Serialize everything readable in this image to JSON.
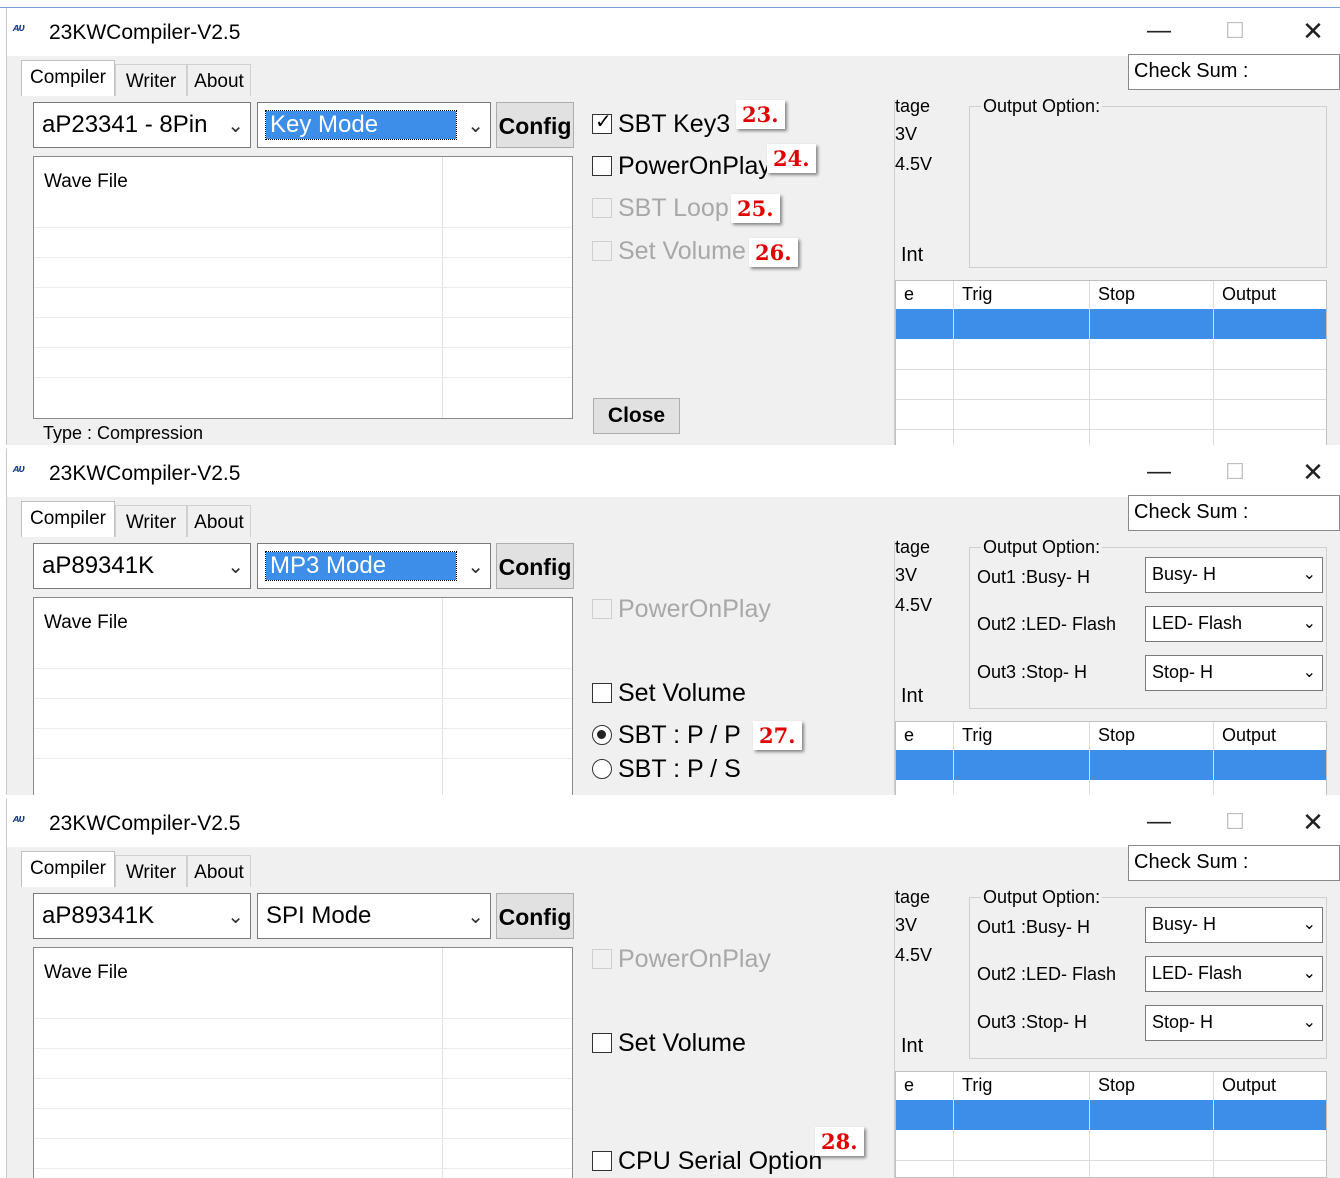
{
  "app": {
    "title": "23KWCompiler-V2.5",
    "icon_text": "ᴀᴜ",
    "minimize": "—",
    "maximize": "☐",
    "close": "✕"
  },
  "tabs": [
    "Compiler",
    "Writer",
    "About"
  ],
  "checksum_label": "Check Sum :",
  "config_label": "Config",
  "wave_file_label": "Wave File",
  "fragments": {
    "voltage": "tage",
    "v3": "3V",
    "v45": "4.5V",
    "int": "Int",
    "grid_first": "e"
  },
  "output_option_label": "Output Option:",
  "grid_headers": [
    "Trig",
    "Stop",
    "Output"
  ],
  "colors": {
    "selection": "#3d8ee8",
    "badge_red": "#e00000"
  },
  "panel1": {
    "chip": "aP23341 - 8Pin",
    "mode": "Key Mode",
    "options": [
      {
        "label": "SBT Key3",
        "checked": true,
        "enabled": true,
        "badge": "23."
      },
      {
        "label": "PowerOnPlay",
        "checked": false,
        "enabled": true,
        "badge": "24."
      },
      {
        "label": "SBT Loop",
        "checked": false,
        "enabled": false,
        "badge": "25."
      },
      {
        "label": "Set Volume",
        "checked": false,
        "enabled": false,
        "badge": "26."
      }
    ],
    "close_label": "Close",
    "type_label": "Type : Compression"
  },
  "panel2": {
    "chip": "aP89341K",
    "mode": "MP3 Mode",
    "poweron": "PowerOnPlay",
    "set_volume": "Set Volume",
    "radio1": "SBT : P / P",
    "radio2": "SBT : P / S",
    "badge": "27.",
    "outputs": [
      {
        "label": "Out1 :Busy- H",
        "value": "Busy- H"
      },
      {
        "label": "Out2 :LED- Flash",
        "value": "LED- Flash"
      },
      {
        "label": "Out3 :Stop- H",
        "value": "Stop- H"
      }
    ]
  },
  "panel3": {
    "chip": "aP89341K",
    "mode": "SPI Mode",
    "poweron": "PowerOnPlay",
    "set_volume": "Set Volume",
    "cpu_serial": "CPU Serial Option",
    "badge": "28.",
    "outputs": [
      {
        "label": "Out1 :Busy- H",
        "value": "Busy- H"
      },
      {
        "label": "Out2 :LED- Flash",
        "value": "LED- Flash"
      },
      {
        "label": "Out3 :Stop- H",
        "value": "Stop- H"
      }
    ]
  }
}
